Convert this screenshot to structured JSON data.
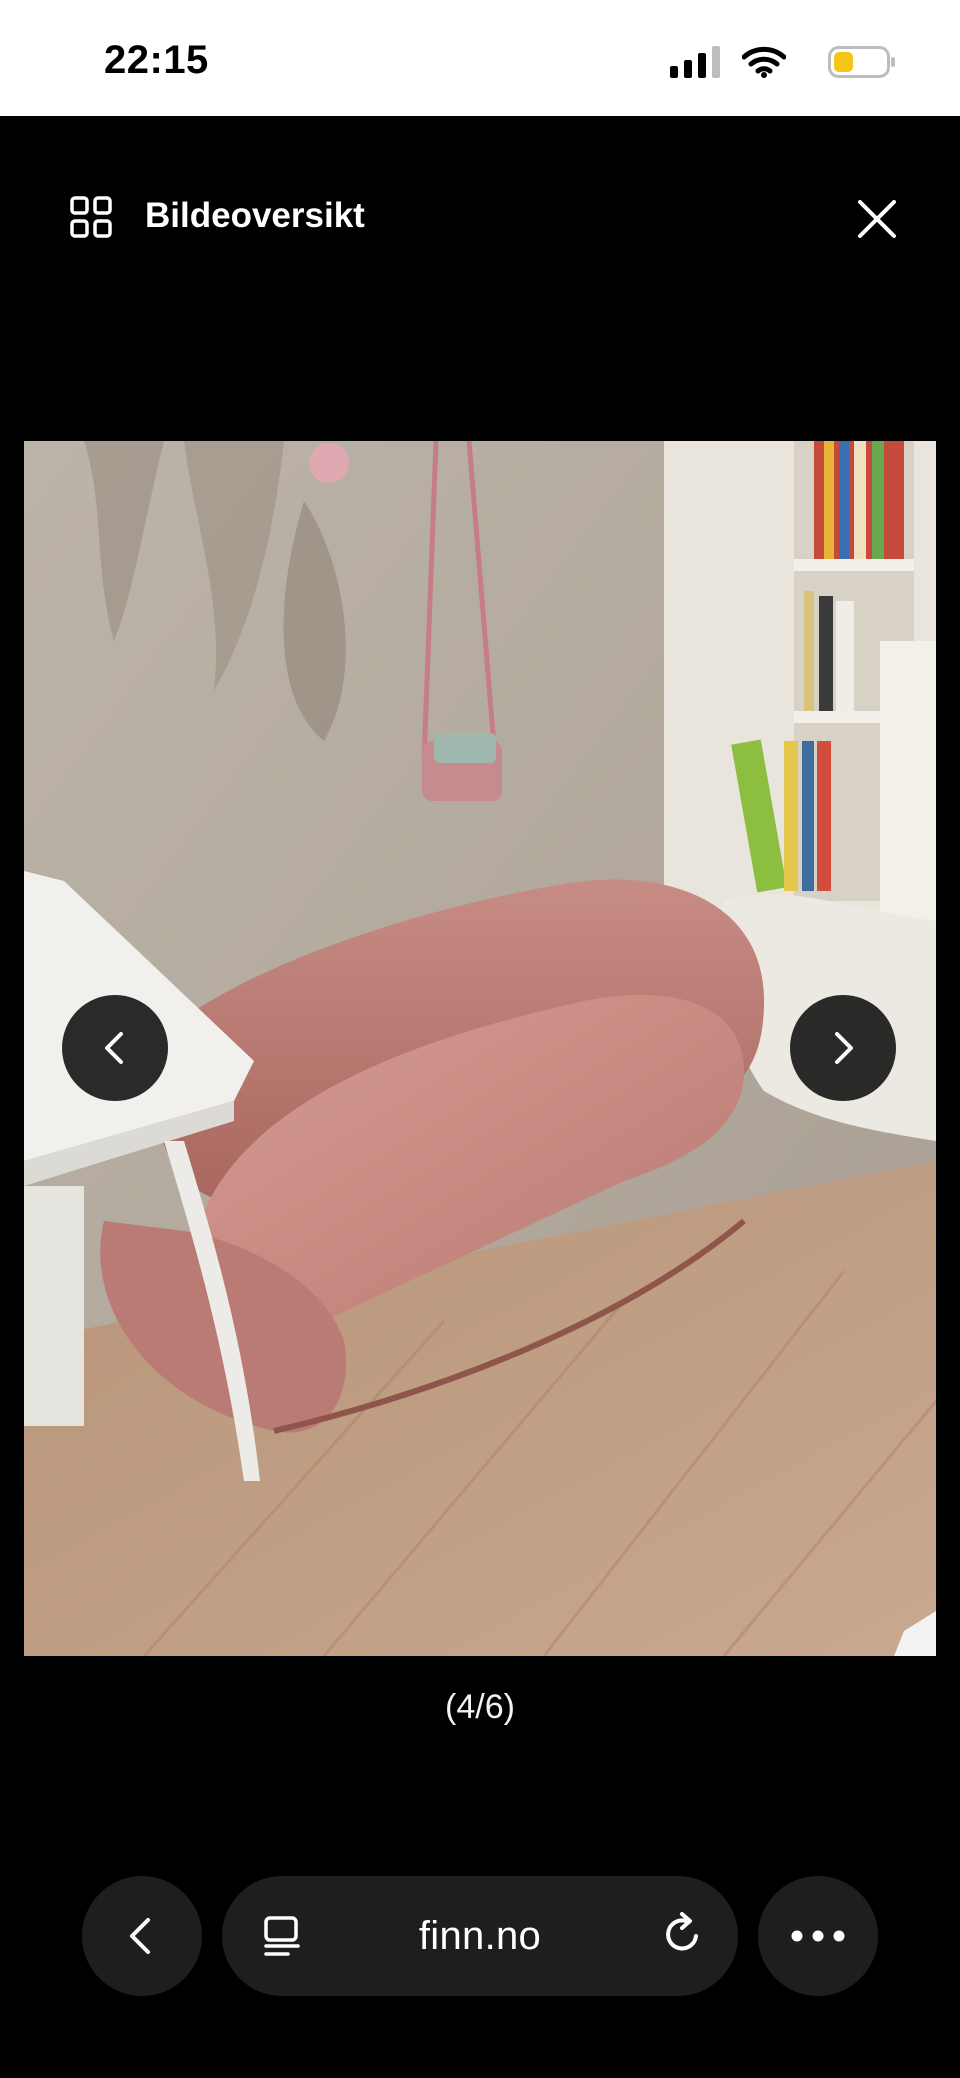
{
  "status_bar": {
    "time": "22:15",
    "icons": [
      "signal-icon",
      "wifi-icon",
      "battery-icon"
    ],
    "battery_color": "#f5c518"
  },
  "header": {
    "title": "Bildeoversikt",
    "icons": [
      "grid-icon",
      "close-icon"
    ]
  },
  "photo": {
    "counter": "(4/6)",
    "nav_icons": [
      "chevron-left-icon",
      "chevron-right-icon"
    ]
  },
  "browser": {
    "url": "finn.no",
    "icons": [
      "back-icon",
      "reader-icon",
      "reload-icon",
      "more-icon"
    ]
  }
}
